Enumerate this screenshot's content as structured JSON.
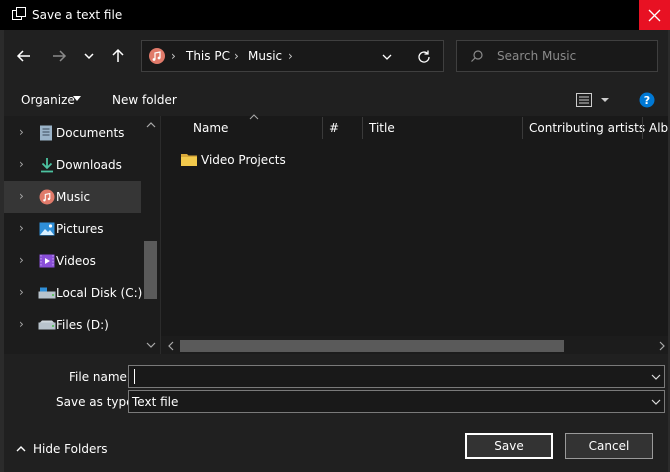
{
  "window": {
    "title": "Save a text file"
  },
  "address": {
    "segments": [
      "This PC",
      "Music"
    ]
  },
  "search": {
    "placeholder": "Search Music"
  },
  "toolbar": {
    "organize_label": "Organize",
    "new_folder_label": "New folder"
  },
  "nav": {
    "items": [
      {
        "label": "Documents",
        "icon": "documents-icon"
      },
      {
        "label": "Downloads",
        "icon": "downloads-icon"
      },
      {
        "label": "Music",
        "icon": "music-icon",
        "selected": true
      },
      {
        "label": "Pictures",
        "icon": "pictures-icon"
      },
      {
        "label": "Videos",
        "icon": "videos-icon"
      },
      {
        "label": "Local Disk (C:)",
        "icon": "local-disk-icon"
      },
      {
        "label": "Files (D:)",
        "icon": "drive-icon"
      }
    ]
  },
  "columns": [
    "Name",
    "#",
    "Title",
    "Contributing artists",
    "Albu"
  ],
  "files": [
    {
      "name": "Video Projects",
      "type": "folder"
    }
  ],
  "form": {
    "file_name_label": "File name:",
    "file_name_value": "",
    "save_type_label": "Save as type:",
    "save_type_value": "Text file"
  },
  "footer": {
    "hide_folders_label": "Hide Folders",
    "save_label": "Save",
    "cancel_label": "Cancel"
  },
  "colors": {
    "title_bar": "#000000",
    "close_button": "#e81123",
    "help_accent": "#0078d4",
    "folder": "#f2c94c"
  }
}
